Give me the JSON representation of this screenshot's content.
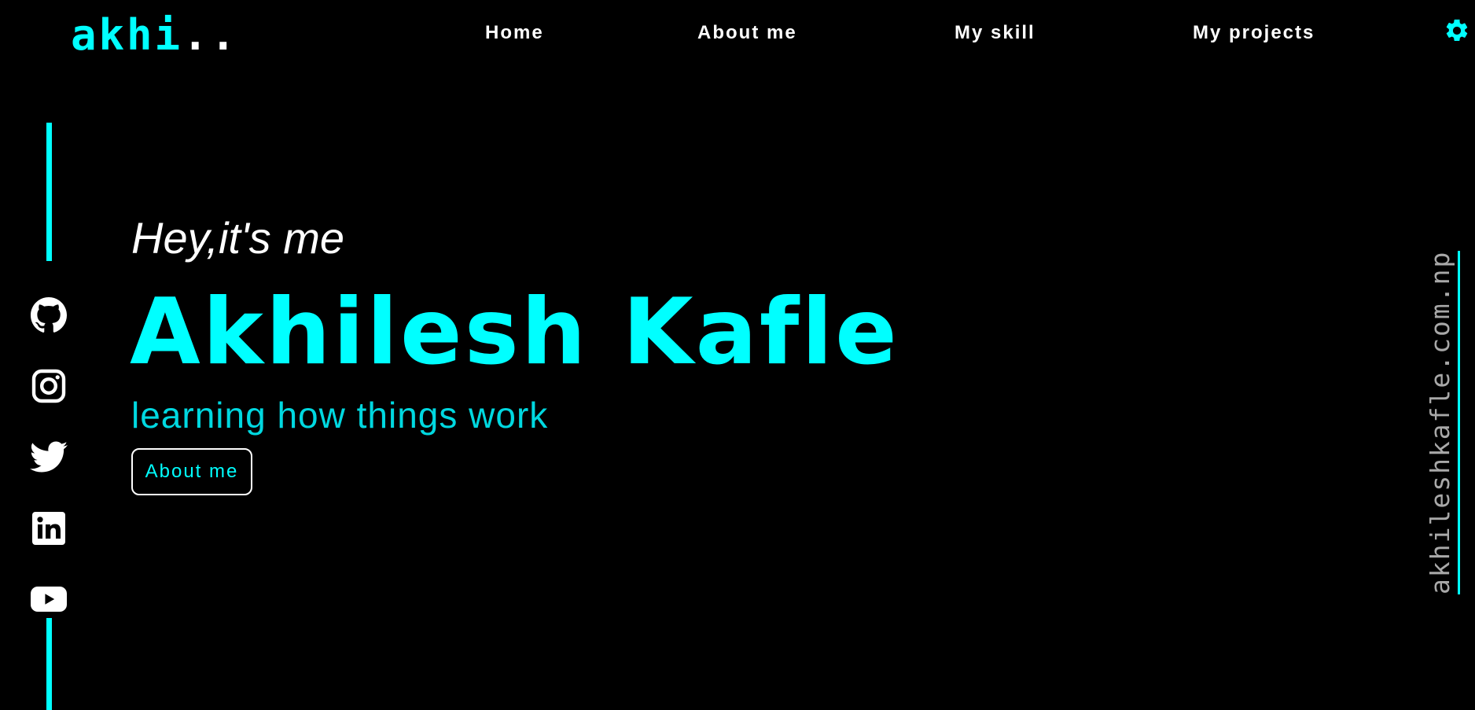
{
  "header": {
    "logo_text": "akhi",
    "logo_dots": "..",
    "nav": {
      "home": "Home",
      "about": "About me",
      "skill": "My skill",
      "projects": "My projects"
    },
    "settings_icon": "gear-icon"
  },
  "social": {
    "items": [
      {
        "name": "github-icon"
      },
      {
        "name": "instagram-icon"
      },
      {
        "name": "twitter-icon"
      },
      {
        "name": "linkedin-icon"
      },
      {
        "name": "youtube-icon"
      }
    ]
  },
  "hero": {
    "greeting": "Hey,it's me",
    "name": "Akhilesh Kafle",
    "tagline": "learning how things work",
    "cta_label": "About me"
  },
  "sidebar_right": {
    "email": "akhileshkafle.com.np"
  },
  "colors": {
    "background": "#000000",
    "accent": "#00ffff",
    "text": "#ffffff",
    "muted": "#a8a8a8"
  }
}
